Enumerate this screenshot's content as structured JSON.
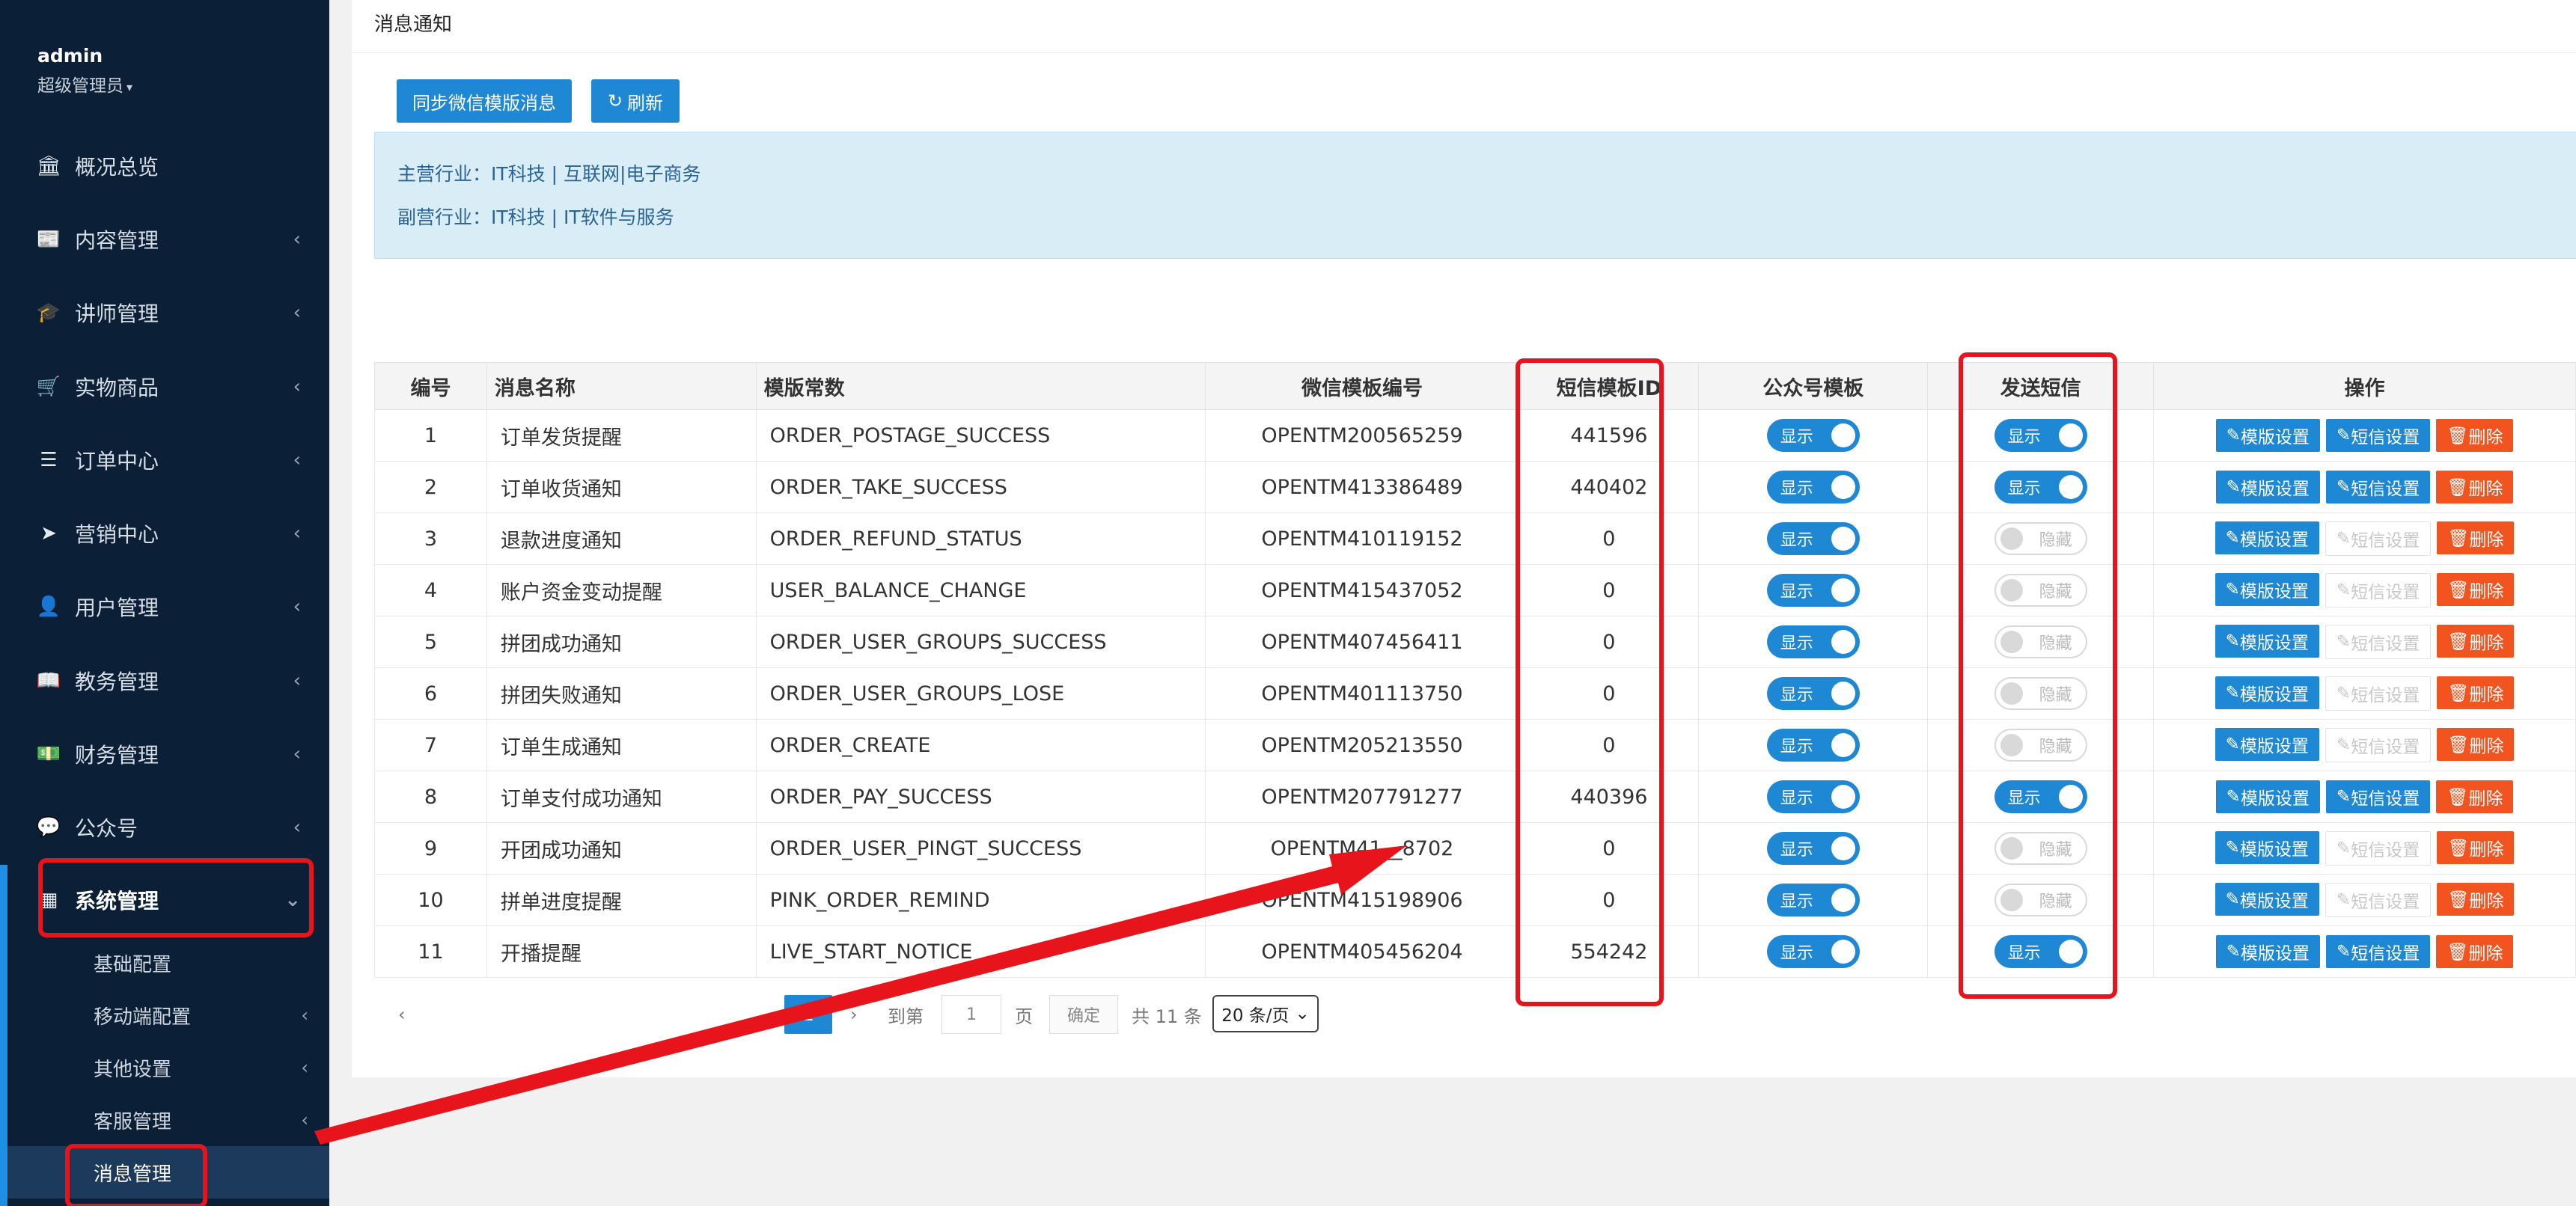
{
  "sidebar": {
    "user_name": "admin",
    "user_role": "超级管理员",
    "items": [
      {
        "label": "概况总览",
        "icon": "bank-icon",
        "glyph": "🏛"
      },
      {
        "label": "内容管理",
        "icon": "newspaper-icon",
        "glyph": "📰"
      },
      {
        "label": "讲师管理",
        "icon": "graduation-cap-icon",
        "glyph": "🎓"
      },
      {
        "label": "实物商品",
        "icon": "cart-icon",
        "glyph": "🛒"
      },
      {
        "label": "订单中心",
        "icon": "list-icon",
        "glyph": "☰"
      },
      {
        "label": "营销中心",
        "icon": "paper-plane-icon",
        "glyph": "➤"
      },
      {
        "label": "用户管理",
        "icon": "user-icon",
        "glyph": "👤"
      },
      {
        "label": "教务管理",
        "icon": "book-icon",
        "glyph": "📖"
      },
      {
        "label": "财务管理",
        "icon": "money-icon",
        "glyph": "💵"
      },
      {
        "label": "公众号",
        "icon": "wechat-icon",
        "glyph": "💬"
      },
      {
        "label": "系统管理",
        "icon": "grid-icon",
        "glyph": "▦"
      }
    ],
    "sub_items": [
      "基础配置",
      "移动端配置",
      "其他设置",
      "客服管理",
      "消息管理"
    ]
  },
  "panel": {
    "title": "消息通知",
    "sync_button": "同步微信模版消息",
    "refresh_button": "刷新",
    "main_industry": "主营行业：IT科技 | 互联网|电子商务",
    "sub_industry": "副营行业：IT科技 | IT软件与服务"
  },
  "table": {
    "headers": [
      "编号",
      "消息名称",
      "模版常数",
      "微信模板编号",
      "短信模板ID",
      "公众号模板",
      "发送短信",
      "操作"
    ],
    "toggle_on": "显示",
    "toggle_off": "隐藏",
    "op_template": "模版设置",
    "op_sms": "短信设置",
    "op_delete": "删除",
    "rows": [
      {
        "id": "1",
        "name": "订单发货提醒",
        "const": "ORDER_POSTAGE_SUCCESS",
        "wx": "OPENTM200565259",
        "sms_id": "441596",
        "send_sms": true
      },
      {
        "id": "2",
        "name": "订单收货通知",
        "const": "ORDER_TAKE_SUCCESS",
        "wx": "OPENTM413386489",
        "sms_id": "440402",
        "send_sms": true
      },
      {
        "id": "3",
        "name": "退款进度通知",
        "const": "ORDER_REFUND_STATUS",
        "wx": "OPENTM410119152",
        "sms_id": "0",
        "send_sms": false
      },
      {
        "id": "4",
        "name": "账户资金变动提醒",
        "const": "USER_BALANCE_CHANGE",
        "wx": "OPENTM415437052",
        "sms_id": "0",
        "send_sms": false
      },
      {
        "id": "5",
        "name": "拼团成功通知",
        "const": "ORDER_USER_GROUPS_SUCCESS",
        "wx": "OPENTM407456411",
        "sms_id": "0",
        "send_sms": false
      },
      {
        "id": "6",
        "name": "拼团失败通知",
        "const": "ORDER_USER_GROUPS_LOSE",
        "wx": "OPENTM401113750",
        "sms_id": "0",
        "send_sms": false
      },
      {
        "id": "7",
        "name": "订单生成通知",
        "const": "ORDER_CREATE",
        "wx": "OPENTM205213550",
        "sms_id": "0",
        "send_sms": false
      },
      {
        "id": "8",
        "name": "订单支付成功通知",
        "const": "ORDER_PAY_SUCCESS",
        "wx": "OPENTM207791277",
        "sms_id": "440396",
        "send_sms": true
      },
      {
        "id": "9",
        "name": "开团成功通知",
        "const": "ORDER_USER_PINGT_SUCCESS",
        "wx": "OPENTM41__8702",
        "sms_id": "0",
        "send_sms": false
      },
      {
        "id": "10",
        "name": "拼单进度提醒",
        "const": "PINK_ORDER_REMIND",
        "wx": "OPENTM415198906",
        "sms_id": "0",
        "send_sms": false
      },
      {
        "id": "11",
        "name": "开播提醒",
        "const": "LIVE_START_NOTICE",
        "wx": "OPENTM405456204",
        "sms_id": "554242",
        "send_sms": true
      }
    ]
  },
  "pager": {
    "current": "1",
    "goto_label": "到第",
    "page_value": "1",
    "page_unit": "页",
    "confirm": "确定",
    "total": "共 11 条",
    "per_page": "20 条/页"
  },
  "colors": {
    "sidebar_bg": "#0b1f37",
    "primary": "#1e88d4",
    "danger": "#f2541f",
    "annotation": "#e8141c"
  }
}
